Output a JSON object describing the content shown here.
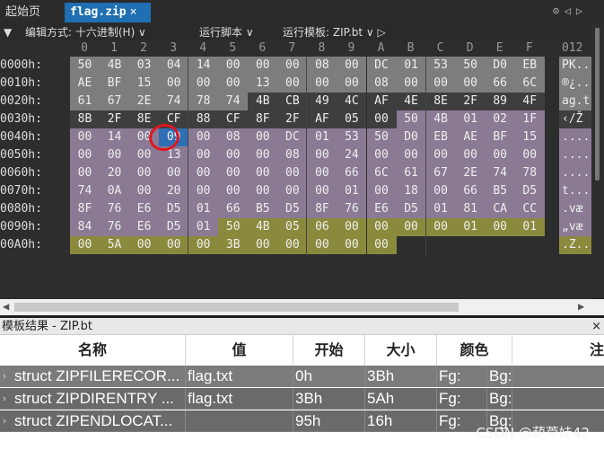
{
  "tabs": [
    {
      "label": "起始页"
    },
    {
      "label": "flag.zip",
      "close": "×"
    }
  ],
  "tab_nav": [
    "⊙",
    "◁",
    "▷"
  ],
  "toolbar": {
    "menu_arrow": "▼",
    "edit_mode": "编辑方式: 十六进制(H) ∨",
    "run_script": "运行脚本 ∨",
    "run_template": "运行模板: ZIP.bt ∨ ▷"
  },
  "column_headers": [
    "0",
    "1",
    "2",
    "3",
    "4",
    "5",
    "6",
    "7",
    "8",
    "9",
    "A",
    "B",
    "C",
    "D",
    "E",
    "F",
    "012"
  ],
  "rows": [
    {
      "addr": "0000h:",
      "bytes": [
        "50",
        "4B",
        "03",
        "04",
        "14",
        "00",
        "00",
        "00",
        "08",
        "00",
        "DC",
        "01",
        "53",
        "50",
        "D0",
        "EB"
      ],
      "ascii": "PK.."
    },
    {
      "addr": "0010h:",
      "bytes": [
        "AE",
        "BF",
        "15",
        "00",
        "00",
        "00",
        "13",
        "00",
        "00",
        "00",
        "08",
        "00",
        "00",
        "00",
        "66",
        "6C"
      ],
      "ascii": "®¿.."
    },
    {
      "addr": "0020h:",
      "bytes": [
        "61",
        "67",
        "2E",
        "74",
        "78",
        "74",
        "4B",
        "CB",
        "49",
        "4C",
        "AF",
        "4E",
        "8E",
        "2F",
        "89",
        "4F"
      ],
      "ascii": "ag.t"
    },
    {
      "addr": "0030h:",
      "bytes": [
        "8B",
        "2F",
        "8E",
        "CF",
        "88",
        "CF",
        "8F",
        "2F",
        "AF",
        "05",
        "00",
        "50",
        "4B",
        "01",
        "02",
        "1F"
      ],
      "ascii": "‹/Ž"
    },
    {
      "addr": "0040h:",
      "bytes": [
        "00",
        "14",
        "00",
        "09",
        "00",
        "08",
        "00",
        "DC",
        "01",
        "53",
        "50",
        "D0",
        "EB",
        "AE",
        "BF",
        "15"
      ],
      "ascii": "...."
    },
    {
      "addr": "0050h:",
      "bytes": [
        "00",
        "00",
        "00",
        "13",
        "00",
        "00",
        "00",
        "08",
        "00",
        "24",
        "00",
        "00",
        "00",
        "00",
        "00",
        "00"
      ],
      "ascii": "...."
    },
    {
      "addr": "0060h:",
      "bytes": [
        "00",
        "20",
        "00",
        "00",
        "00",
        "00",
        "00",
        "00",
        "00",
        "66",
        "6C",
        "61",
        "67",
        "2E",
        "74",
        "78"
      ],
      "ascii": "...."
    },
    {
      "addr": "0070h:",
      "bytes": [
        "74",
        "0A",
        "00",
        "20",
        "00",
        "00",
        "00",
        "00",
        "00",
        "01",
        "00",
        "18",
        "00",
        "66",
        "B5",
        "D5"
      ],
      "ascii": "t..."
    },
    {
      "addr": "0080h:",
      "bytes": [
        "8F",
        "76",
        "E6",
        "D5",
        "01",
        "66",
        "B5",
        "D5",
        "8F",
        "76",
        "E6",
        "D5",
        "01",
        "81",
        "CA",
        "CC"
      ],
      "ascii": ".væ"
    },
    {
      "addr": "0090h:",
      "bytes": [
        "84",
        "76",
        "E6",
        "D5",
        "01",
        "50",
        "4B",
        "05",
        "06",
        "00",
        "00",
        "00",
        "00",
        "01",
        "00",
        "01"
      ],
      "ascii": "„væ"
    },
    {
      "addr": "00A0h:",
      "bytes": [
        "00",
        "5A",
        "00",
        "00",
        "00",
        "3B",
        "00",
        "00",
        "00",
        "00",
        "00"
      ],
      "ascii": ".Z.."
    }
  ],
  "colors": {
    "local_header": "#7d7d7d",
    "compressed_data": "#3e3e3e",
    "central_dir": "#8a7a94",
    "end_locator": "#8a8a3c",
    "selected_byte": "#2f6fb3",
    "annotation": "#e0161e"
  },
  "panel": {
    "title": "模板结果 - ZIP.bt",
    "close": "×",
    "headers": [
      "名称",
      "值",
      "开始",
      "大小",
      "颜色",
      "注"
    ],
    "rows": [
      {
        "name": "struct ZIPFILERECOR...",
        "value": "flag.txt",
        "start": "0h",
        "size": "3Bh",
        "fg": "Fg:",
        "bg": "Bg:"
      },
      {
        "name": "struct ZIPDIRENTRY ...",
        "value": "flag.txt",
        "start": "3Bh",
        "size": "5Ah",
        "fg": "Fg:",
        "bg": "Bg:"
      },
      {
        "name": "struct ZIPENDLOCAT...",
        "value": "",
        "start": "95h",
        "size": "16h",
        "fg": "Fg:",
        "bg": "Bg:"
      }
    ]
  },
  "watermark": "CSDN @葫芦娃42"
}
